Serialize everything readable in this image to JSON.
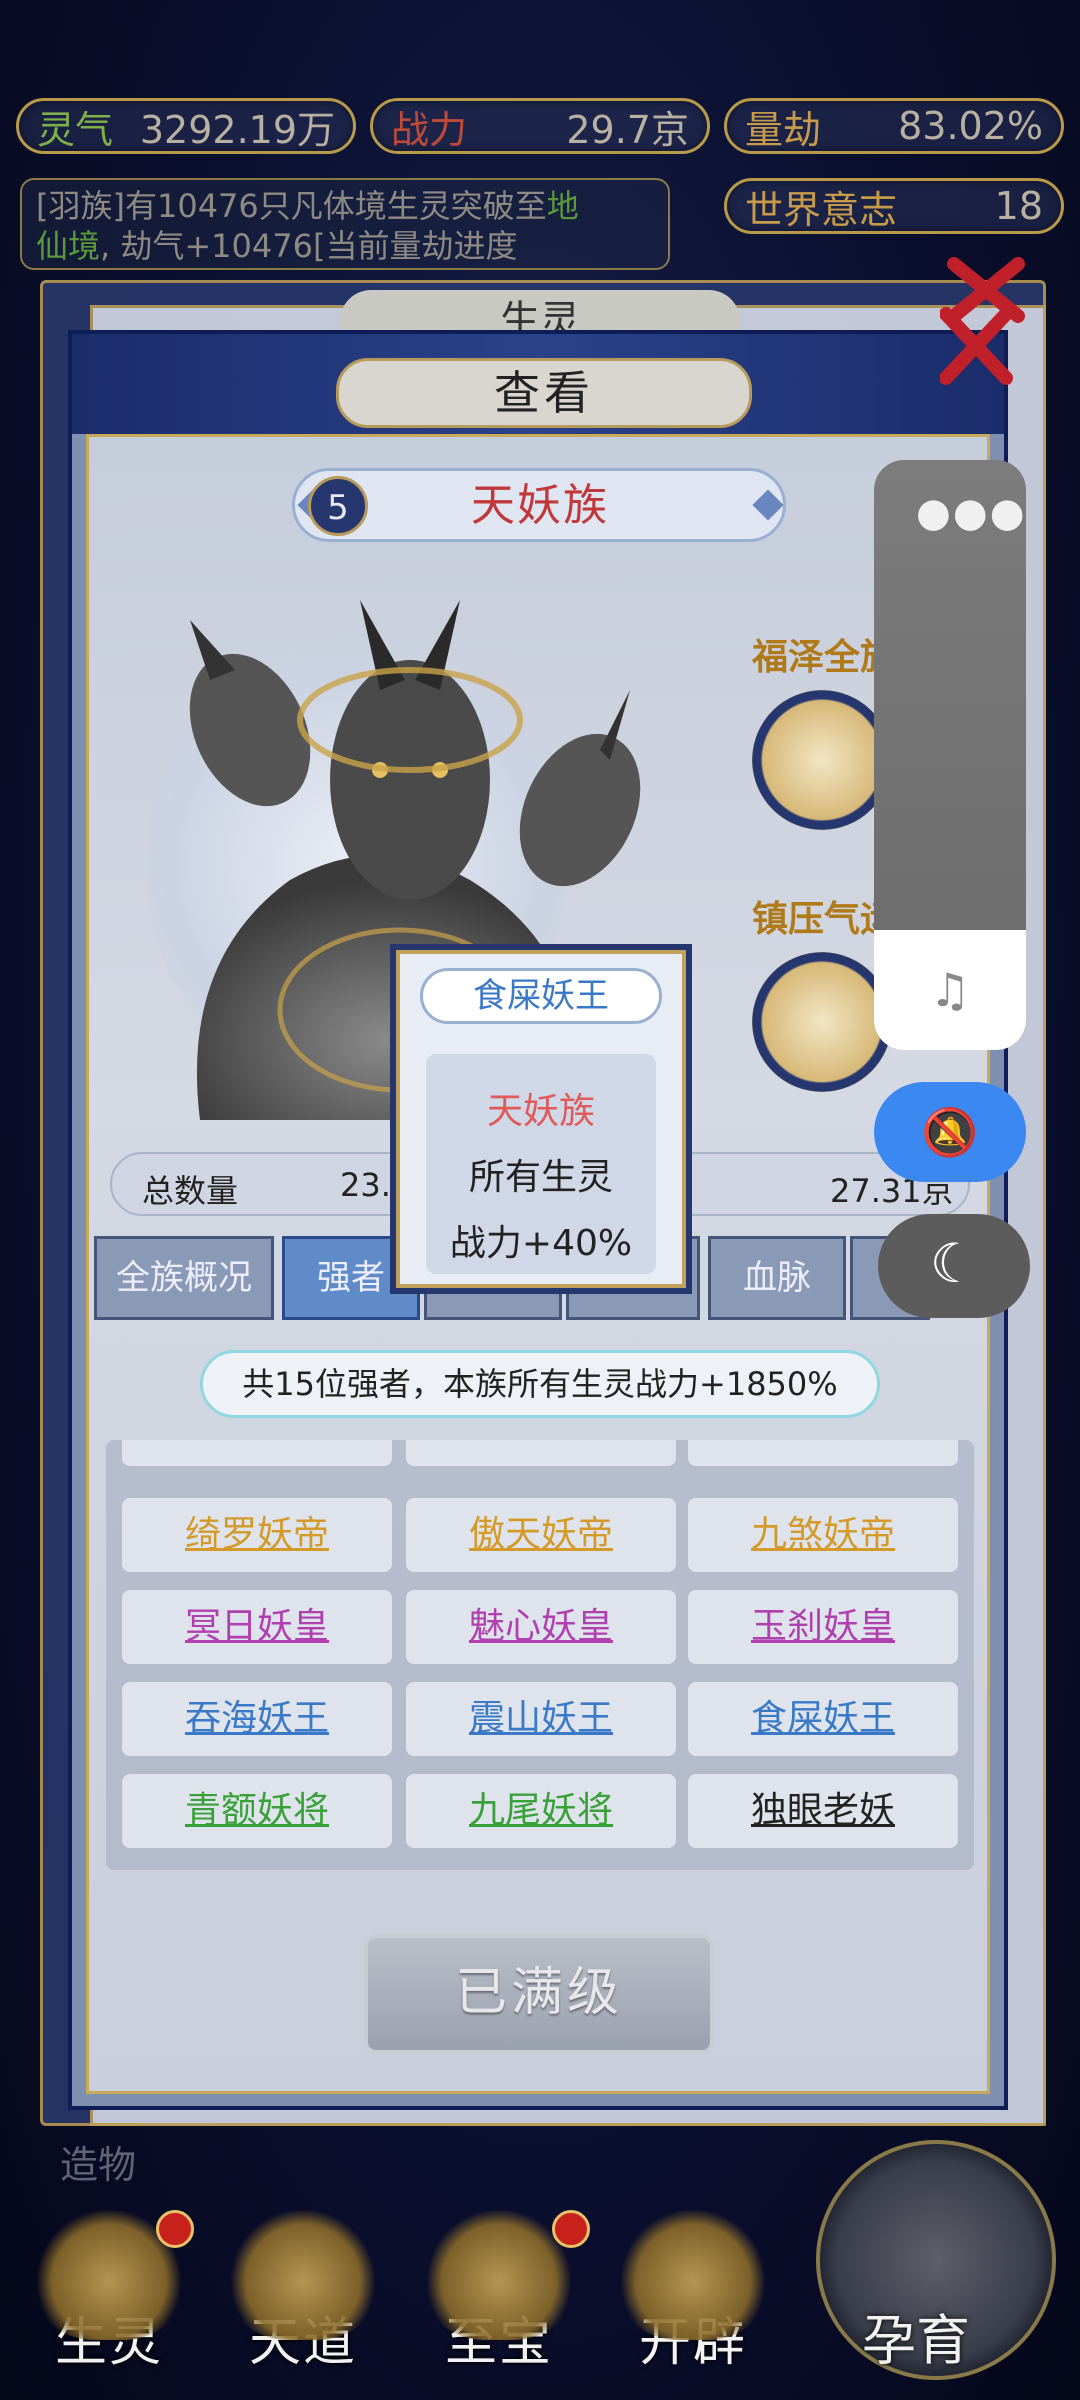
{
  "top_stats": [
    {
      "key": "灵气",
      "value": "3292.19万"
    },
    {
      "key": "战力",
      "value": "29.7京"
    },
    {
      "key": "量劫",
      "value": "83.02%"
    },
    {
      "key": "世界意志",
      "value": "18"
    }
  ],
  "log": {
    "line1_prefix": "[羽族]有10476只凡体境生灵突破至",
    "line1_highlight": "地",
    "line2_highlight": "仙境",
    "line2_suffix": ", 劫气+10476[当前量劫进度"
  },
  "back_panel_title": "生灵",
  "dialog": {
    "title": "查看",
    "race_number": "5",
    "race_name": "天妖族",
    "skills": [
      {
        "label": "福泽全族"
      },
      {
        "label": "镇压气运"
      }
    ],
    "total_label": "总数量",
    "total_left_value": "23.2",
    "total_right_value": "27.31京",
    "tabs": [
      "全族概况",
      "强者",
      "",
      "",
      "血脉",
      ""
    ],
    "active_tab_index": 1,
    "summary": "共15位强者，本族所有生灵战力+1850%",
    "strongmen": [
      {
        "name": "绮罗妖帝",
        "color": "orange"
      },
      {
        "name": "傲天妖帝",
        "color": "orange"
      },
      {
        "name": "九煞妖帝",
        "color": "orange"
      },
      {
        "name": "冥日妖皇",
        "color": "purple"
      },
      {
        "name": "魅心妖皇",
        "color": "purple"
      },
      {
        "name": "玉刹妖皇",
        "color": "purple"
      },
      {
        "name": "吞海妖王",
        "color": "blue"
      },
      {
        "name": "震山妖王",
        "color": "blue"
      },
      {
        "name": "食屎妖王",
        "color": "blue"
      },
      {
        "name": "青额妖将",
        "color": "green"
      },
      {
        "name": "九尾妖将",
        "color": "green"
      },
      {
        "name": "独眼老妖",
        "color": "black"
      }
    ],
    "max_button": "已满级"
  },
  "tooltip": {
    "title": "食屎妖王",
    "race": "天妖族",
    "line1": "所有生灵",
    "line2": "战力+40%"
  },
  "floating_menu": {
    "more_icon": "more-dots-icon",
    "music_icon": "music-note-icon",
    "bell_icon": "bell-off-icon",
    "moon_icon": "moon-icon"
  },
  "bottom_nav": [
    {
      "label": "生灵",
      "badge": true
    },
    {
      "label": "天道",
      "badge": false
    },
    {
      "label": "至宝",
      "badge": true
    },
    {
      "label": "开辟",
      "badge": false
    }
  ],
  "nursery_label": "孕育",
  "side_label": "造物",
  "colors": {
    "accent_gold": "#c2a25a",
    "dialog_navy": "#0e1d55",
    "race_red": "#c0383a",
    "bell_blue": "#3a88f0"
  }
}
